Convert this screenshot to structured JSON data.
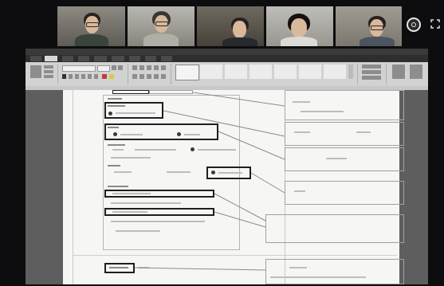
{
  "meeting": {
    "participants": [
      {
        "tile": "participant-1"
      },
      {
        "tile": "participant-2"
      },
      {
        "tile": "participant-3"
      },
      {
        "tile": "participant-4"
      },
      {
        "tile": "participant-5"
      }
    ],
    "settings_icon": "gear-icon",
    "expand_icon": "expand-icon"
  },
  "colors": {
    "background": "#0d0d0f",
    "ribbon": "#d2d2d2",
    "page": "#f6f6f4",
    "highlight_border": "#1f1f1f",
    "callout_border": "#a0a0a0"
  }
}
